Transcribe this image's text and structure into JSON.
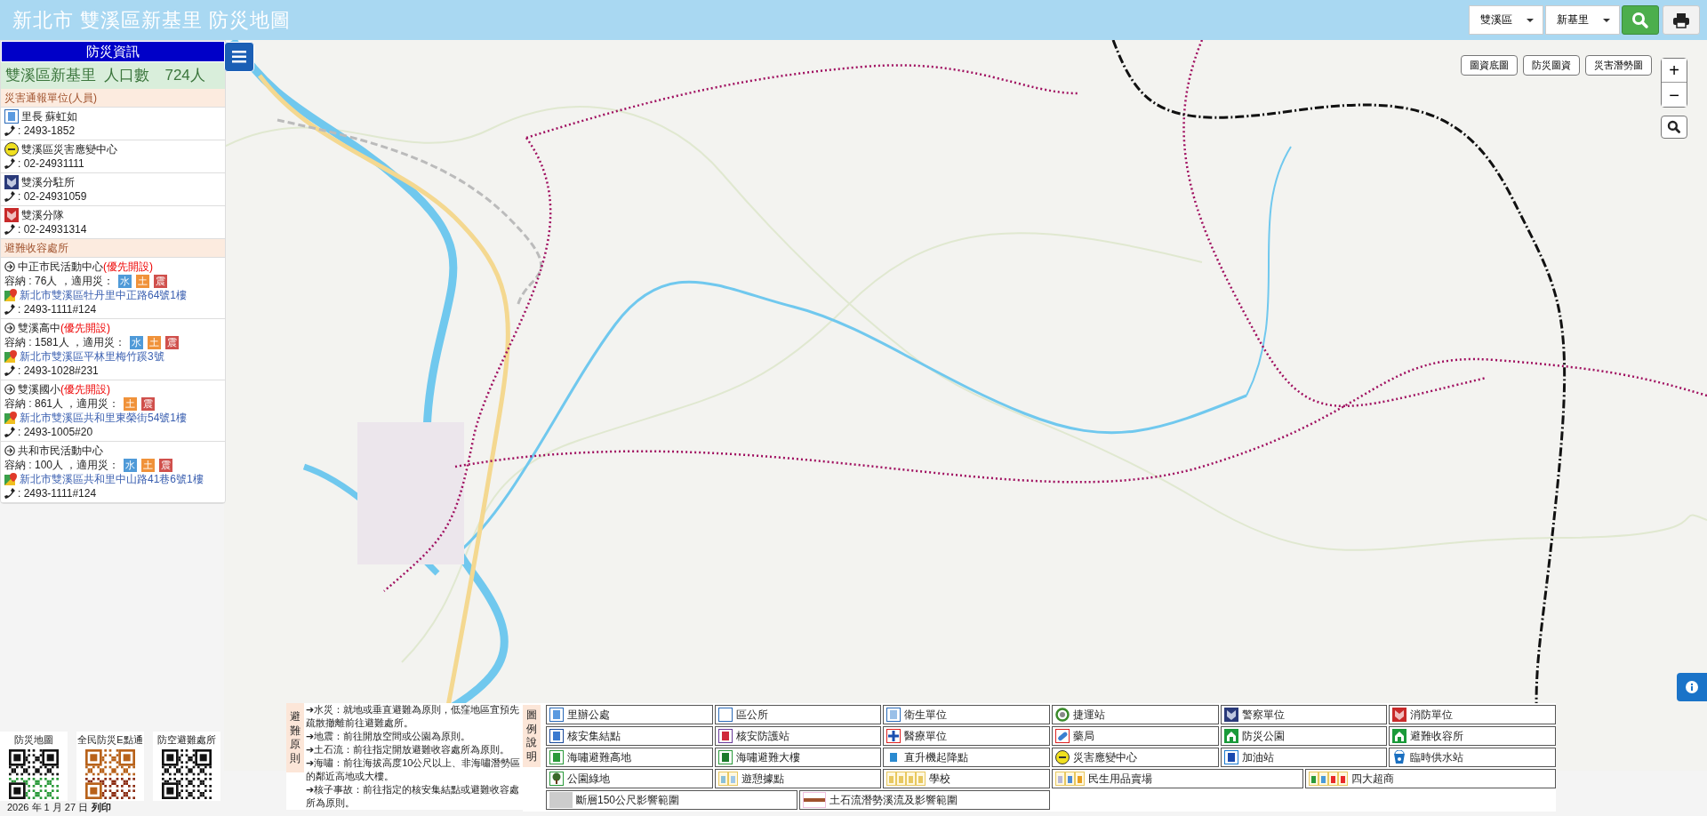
{
  "header": {
    "title": "新北市 雙溪區新基里 防災地圖",
    "district": "雙溪區",
    "village": "新基里"
  },
  "sidebar": {
    "title": "防災資訊",
    "summary": "雙溪區新基里  人口數　724人",
    "contacts_heading": "災害通報單位(人員)",
    "contacts": [
      {
        "name": "里長 蘇虹如",
        "phone": ": 2493-1852"
      },
      {
        "name": "雙溪區災害應變中心",
        "phone": ": 02-24931111"
      },
      {
        "name": "雙溪分駐所",
        "phone": ": 02-24931059"
      },
      {
        "name": "雙溪分隊",
        "phone": ": 02-24931314"
      }
    ],
    "shelters_heading": "避難收容處所",
    "shelters": [
      {
        "name": "中正市民活動中心",
        "priority": "(優先開設)",
        "capacity": "容納 : 76人 ，適用災：",
        "hazards": [
          {
            "label": "水",
            "color": "#4f9ad8"
          },
          {
            "label": "土",
            "color": "#f0923a"
          },
          {
            "label": "震",
            "color": "#d0504c"
          }
        ],
        "address": "新北市雙溪區牡丹里中正路64號1樓",
        "phone": ": 2493-1111#124"
      },
      {
        "name": "雙溪高中",
        "priority": "(優先開設)",
        "capacity": "容納 : 1581人 ，適用災：",
        "hazards": [
          {
            "label": "水",
            "color": "#4f9ad8"
          },
          {
            "label": "土",
            "color": "#f0923a"
          },
          {
            "label": "震",
            "color": "#d0504c"
          }
        ],
        "address": "新北市雙溪區平林里梅竹蹊3號",
        "phone": ": 2493-1028#231"
      },
      {
        "name": "雙溪國小",
        "priority": "(優先開設)",
        "capacity": "容納 : 861人 ，適用災：",
        "hazards": [
          {
            "label": "土",
            "color": "#f0923a"
          },
          {
            "label": "震",
            "color": "#d0504c"
          }
        ],
        "address": "新北市雙溪區共和里東榮街54號1樓",
        "phone": ": 2493-1005#20"
      },
      {
        "name": "共和市民活動中心",
        "capacity": "容納 : 100人 ，適用災：",
        "hazards": [
          {
            "label": "水",
            "color": "#4f9ad8"
          },
          {
            "label": "土",
            "color": "#f0923a"
          },
          {
            "label": "震",
            "color": "#d0504c"
          }
        ],
        "address": "新北市雙溪區共和里中山路41巷6號1樓",
        "phone": ": 2493-1111#124"
      }
    ]
  },
  "map_controls": {
    "layers": [
      "圖資底圖",
      "防災圖資",
      "災害潛勢圖"
    ],
    "zoom_in": "+",
    "zoom_out": "−"
  },
  "qr_codes": [
    {
      "label": "防災地圖"
    },
    {
      "label": "全民防災E點通"
    },
    {
      "label": "防空避難處所"
    }
  ],
  "print": {
    "date": "2026 年 1 月 27 日",
    "link": "列印"
  },
  "principles": {
    "title": "避難原則",
    "items": [
      "➔水災：就地或垂直避難為原則，低窪地區宜預先疏散撤離前往避難處所。",
      "➔地震：前往開放空間或公園為原則。",
      "➔土石流：前往指定開放避難收容處所為原則。",
      "➔海嘯：前往海拔高度10公尺以上、非海嘯潛勢區的鄰近高地或大樓。",
      "➔核子事故：前往指定的核安集結點或避難收容處所為原則。"
    ]
  },
  "legend": {
    "title": "圖例說明",
    "items": [
      {
        "label": "里辦公處",
        "kind": "icon"
      },
      {
        "label": "區公所",
        "kind": "icon"
      },
      {
        "label": "衛生單位",
        "kind": "icon"
      },
      {
        "label": "捷運站",
        "kind": "icon"
      },
      {
        "label": "警察單位",
        "kind": "icon"
      },
      {
        "label": "消防單位",
        "kind": "icon"
      },
      {
        "label": "核安集結點",
        "kind": "icon"
      },
      {
        "label": "核安防護站",
        "kind": "icon"
      },
      {
        "label": "醫療單位",
        "kind": "icon"
      },
      {
        "label": "藥局",
        "kind": "icon"
      },
      {
        "label": "防災公園",
        "kind": "icon"
      },
      {
        "label": "避難收容所",
        "kind": "icon"
      },
      {
        "label": "海嘯避難高地",
        "kind": "icon"
      },
      {
        "label": "海嘯避難大樓",
        "kind": "icon"
      },
      {
        "label": "直升機起降點",
        "kind": "icon"
      },
      {
        "label": "災害應變中心",
        "kind": "icon"
      },
      {
        "label": "加油站",
        "kind": "icon"
      },
      {
        "label": "臨時供水站",
        "kind": "icon"
      },
      {
        "label": "公園綠地",
        "kind": "icon"
      },
      {
        "label": "遊憩據點",
        "kind": "icon"
      },
      {
        "label": "學校",
        "kind": "icon"
      },
      {
        "label": "民生用品賣場",
        "kind": "group"
      },
      {
        "label": "四大超商",
        "kind": "group"
      },
      {
        "label": "斷層150公尺影響範圍",
        "kind": "area"
      },
      {
        "label": "土石流潛勢溪流及影響範圍",
        "kind": "line"
      }
    ]
  }
}
